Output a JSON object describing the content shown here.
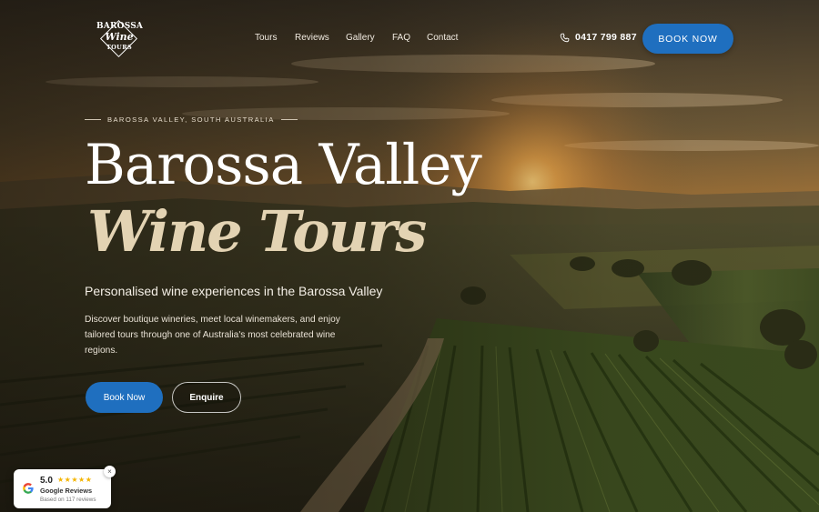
{
  "logo": {
    "line1": "BAROSSA",
    "line2": "Wine",
    "line3": "TOURS"
  },
  "nav": {
    "items": [
      "Tours",
      "Reviews",
      "Gallery",
      "FAQ",
      "Contact"
    ]
  },
  "header": {
    "phone": "0417 799 887",
    "phone_icon": "phone-icon",
    "book_label": "BOOK NOW"
  },
  "hero": {
    "eyebrow": "BAROSSA VALLEY, SOUTH AUSTRALIA",
    "title_line1": "Barossa Valley",
    "title_line2": "Wine Tours",
    "subtitle": "Personalised wine experiences in the Barossa Valley",
    "description": "Discover boutique wineries, meet local winemakers, and enjoy tailored tours through one of Australia's most celebrated wine regions.",
    "primary_button": "Book Now",
    "secondary_button": "Enquire"
  },
  "reviews_widget": {
    "score": "5.0",
    "stars": "★★★★★",
    "label": "Google Reviews",
    "based_on": "Based on 117 reviews",
    "close": "×",
    "icon": "google-icon"
  },
  "colors": {
    "accent": "#1f6fbf",
    "title_italic": "#e3d3b3",
    "star": "#f4b400"
  }
}
